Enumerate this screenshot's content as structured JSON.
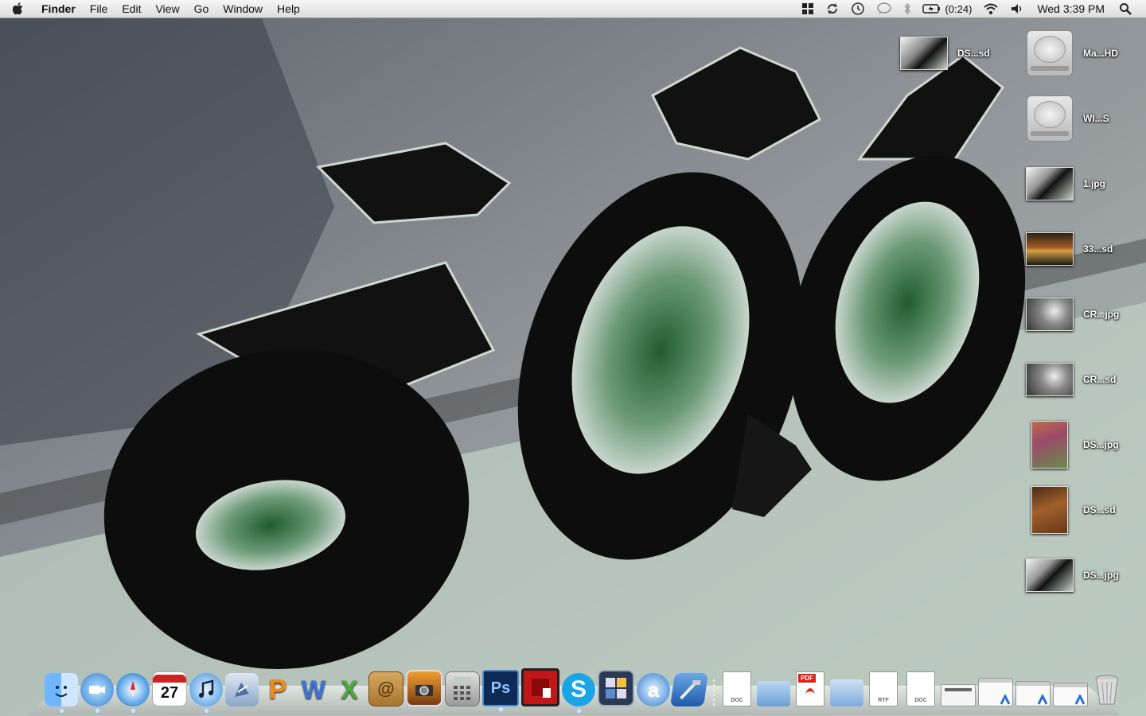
{
  "menubar": {
    "apple_icon": "apple-logo-icon",
    "app_name": "Finder",
    "menus": [
      "File",
      "Edit",
      "View",
      "Go",
      "Window",
      "Help"
    ],
    "status": {
      "battery_text": "(0:24)",
      "clock": "Wed 3:39 PM",
      "icons": [
        "spaces-icon",
        "time-machine-sync-icon",
        "time-machine-icon",
        "ichat-status-icon",
        "bluetooth-icon",
        "battery-icon",
        "wifi-icon",
        "volume-icon",
        "spotlight-icon"
      ]
    }
  },
  "desktop_icons": [
    {
      "label": "DS...sd",
      "kind": "photo",
      "icon": "psd-file-icon"
    },
    {
      "label": "Ma...HD",
      "kind": "hdd",
      "icon": "hard-drive-icon"
    },
    {
      "label": "WI...S",
      "kind": "hdd",
      "icon": "hard-drive-icon"
    },
    {
      "label": "1.jpg",
      "kind": "photo",
      "icon": "jpg-file-icon"
    },
    {
      "label": "33...sd",
      "kind": "photo",
      "icon": "psd-file-icon"
    },
    {
      "label": "CR...jpg",
      "kind": "photo",
      "icon": "jpg-file-icon"
    },
    {
      "label": "CR...sd",
      "kind": "photo",
      "icon": "psd-file-icon"
    },
    {
      "label": "DS...jpg",
      "kind": "photo",
      "icon": "jpg-file-icon"
    },
    {
      "label": "DS...sd",
      "kind": "photo",
      "icon": "psd-file-icon"
    },
    {
      "label": "DS...jpg",
      "kind": "photo",
      "icon": "jpg-file-icon"
    }
  ],
  "dock": {
    "apps": [
      {
        "name": "finder-icon",
        "running": true
      },
      {
        "name": "ichat-icon",
        "running": true
      },
      {
        "name": "safari-icon",
        "running": true
      },
      {
        "name": "ical-icon",
        "running": false,
        "text": "27"
      },
      {
        "name": "itunes-icon",
        "running": true
      },
      {
        "name": "mail-icon",
        "running": false
      },
      {
        "name": "powerpoint-icon",
        "running": false
      },
      {
        "name": "word-icon",
        "running": false
      },
      {
        "name": "excel-icon",
        "running": false
      },
      {
        "name": "address-book-icon",
        "running": false
      },
      {
        "name": "iphoto-icon",
        "running": false
      },
      {
        "name": "calculator-icon",
        "running": false
      },
      {
        "name": "photoshop-icon",
        "running": true,
        "text": "Ps"
      },
      {
        "name": "photo-booth-icon",
        "running": false
      },
      {
        "name": "skype-icon",
        "running": true
      },
      {
        "name": "dashboard-icon",
        "running": false
      },
      {
        "name": "app-store-icon",
        "running": false
      },
      {
        "name": "xcode-icon",
        "running": false
      }
    ],
    "docs": [
      {
        "name": "doc-file-icon",
        "text": "DOC"
      },
      {
        "name": "folder-icon"
      },
      {
        "name": "pdf-file-icon",
        "text": "PDF"
      },
      {
        "name": "folder-stack-icon"
      },
      {
        "name": "rtf-file-icon",
        "text": "RTF"
      },
      {
        "name": "doc-file-icon",
        "text": "DOC"
      },
      {
        "name": "screenshot-stack-icon"
      },
      {
        "name": "window-stack-icon"
      },
      {
        "name": "window-stack-icon"
      },
      {
        "name": "window-stack-icon"
      },
      {
        "name": "trash-icon"
      }
    ]
  },
  "colors": {
    "menubar_bg": "#e9e9e9",
    "label_text": "#ffffff",
    "wallpaper_dark": "#111111",
    "wallpaper_green": "#2e6b3a",
    "wallpaper_grey": "#8a9095"
  }
}
